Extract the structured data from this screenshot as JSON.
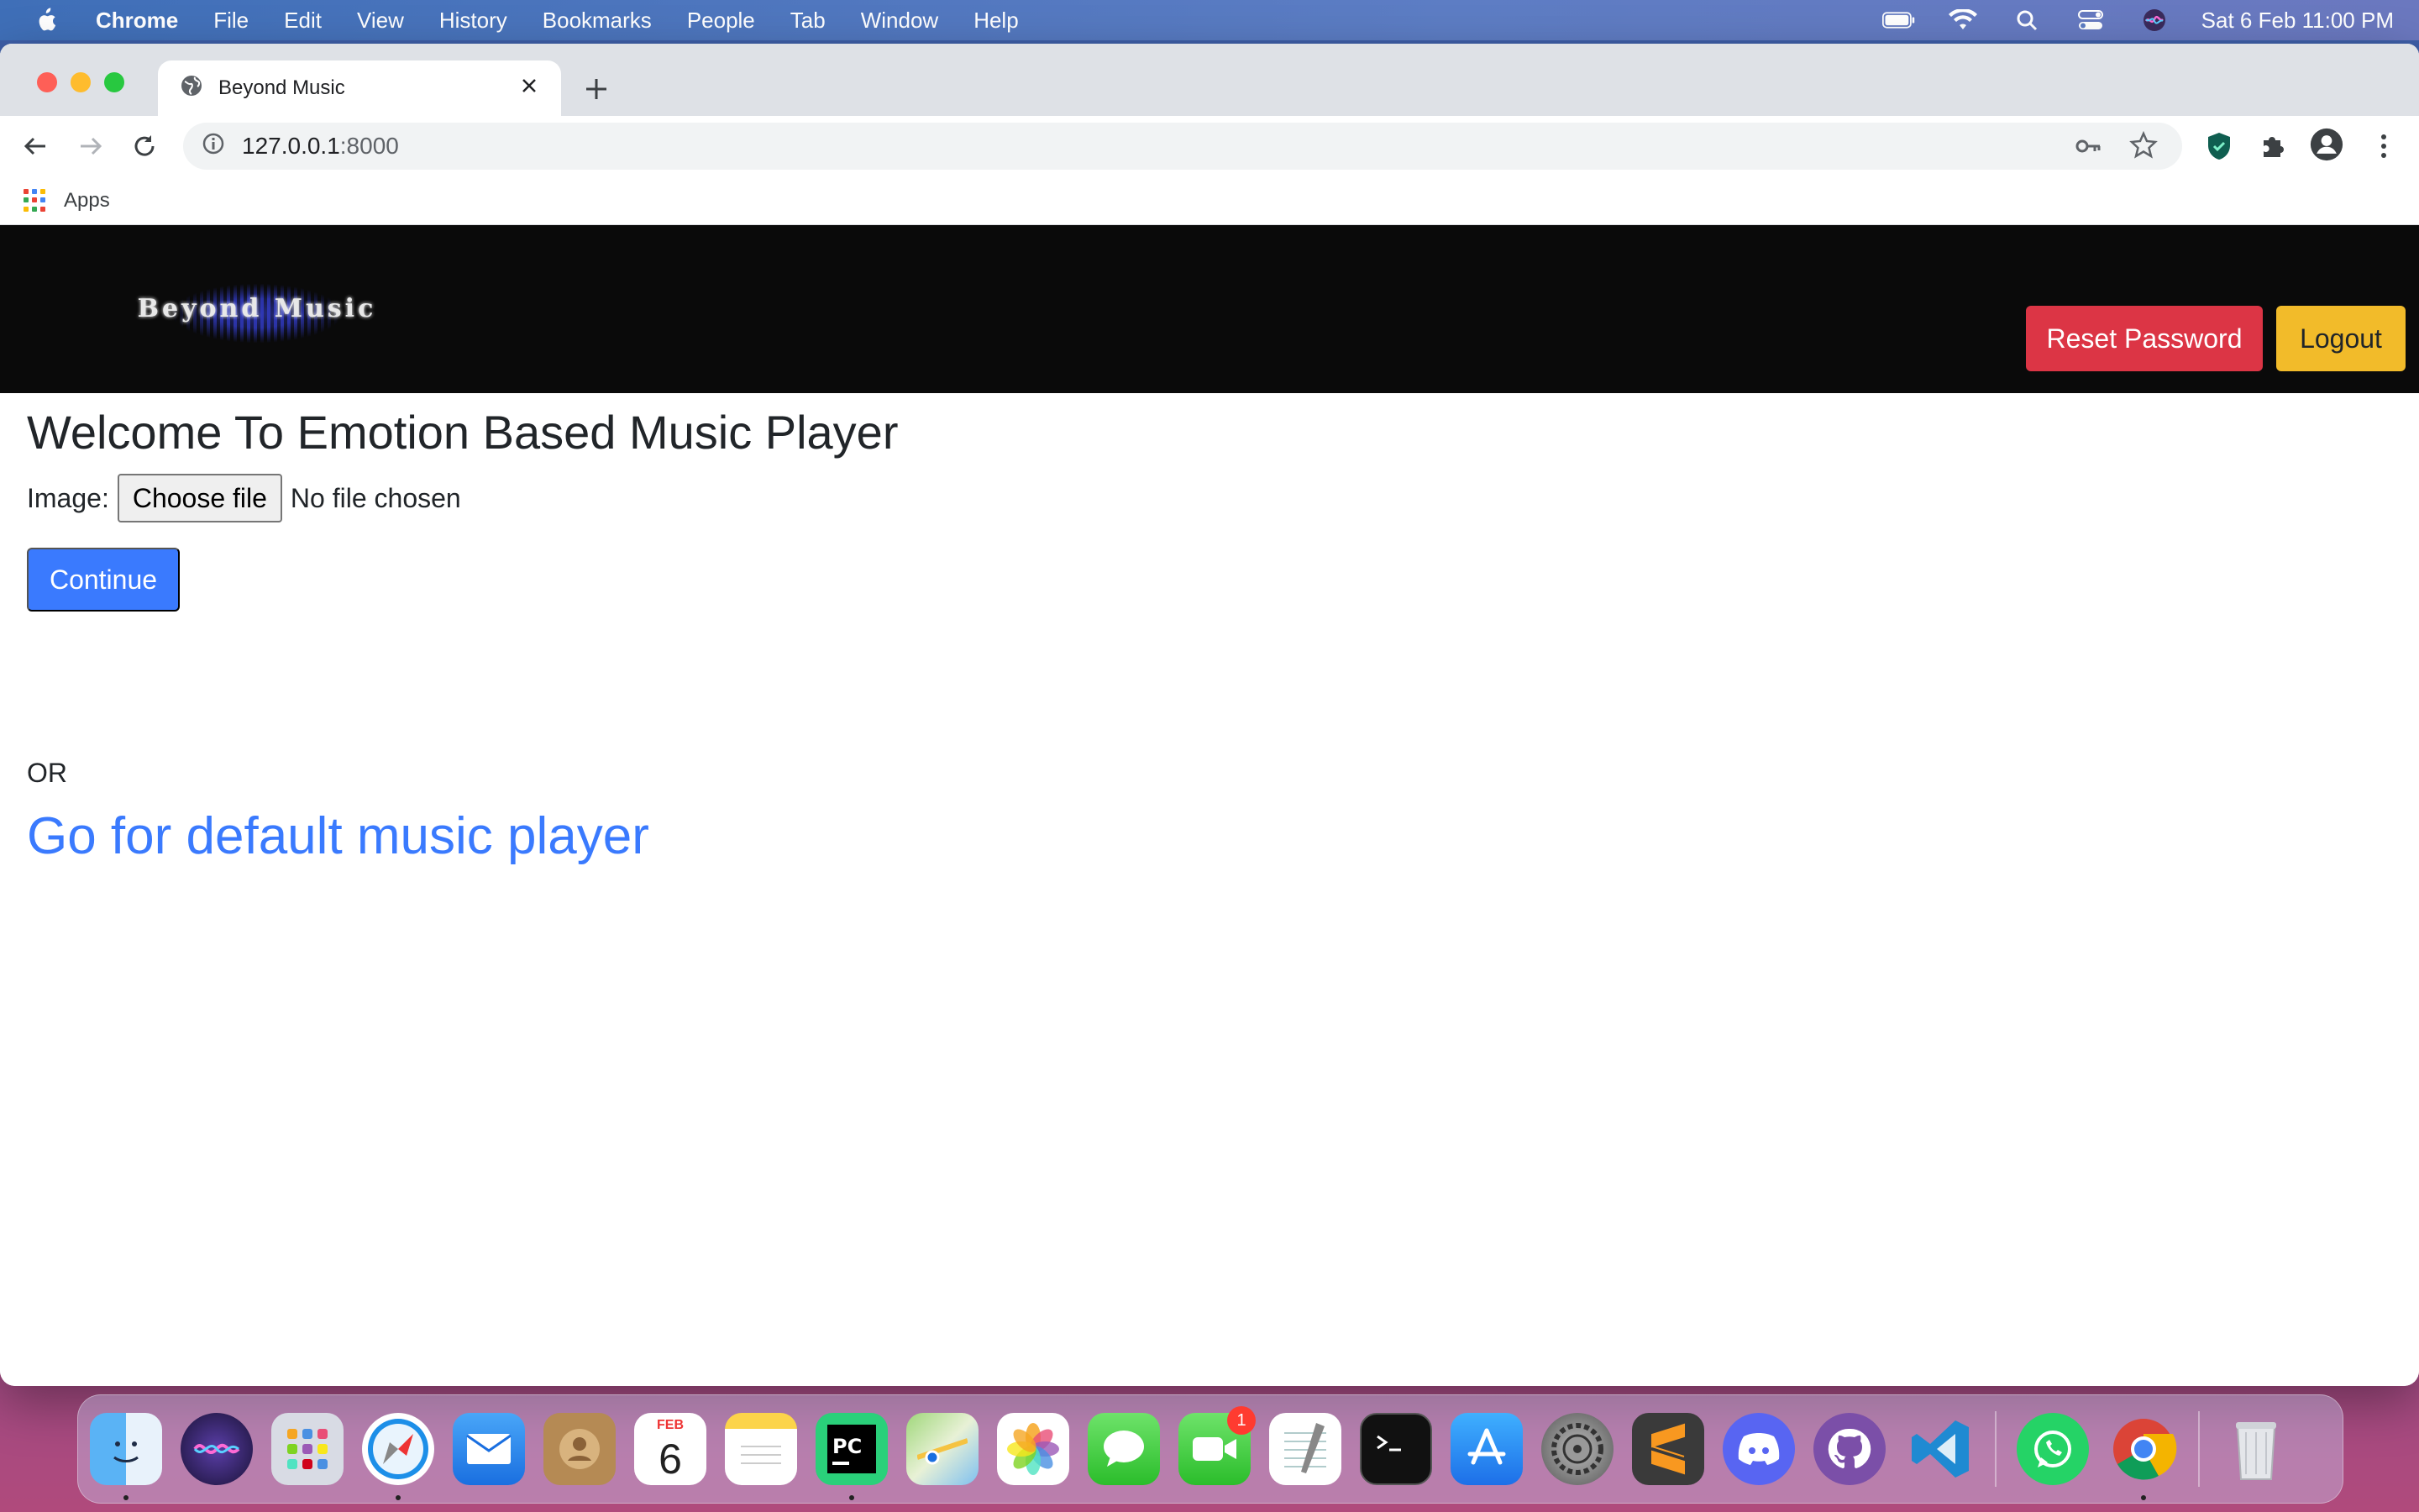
{
  "menubar": {
    "app_name": "Chrome",
    "items": [
      "File",
      "Edit",
      "View",
      "History",
      "Bookmarks",
      "People",
      "Tab",
      "Window",
      "Help"
    ],
    "datetime": "Sat 6 Feb  11:00 PM"
  },
  "browser": {
    "tab_title": "Beyond Music",
    "url_host": "127.0.0.1",
    "url_port": ":8000",
    "bookmarks_apps_label": "Apps"
  },
  "site": {
    "logo_text": "Beyond Music",
    "reset_password_label": "Reset Password",
    "logout_label": "Logout",
    "heading": "Welcome To Emotion Based Music Player",
    "image_label": "Image:",
    "choose_file_label": "Choose file",
    "file_status": "No file chosen",
    "continue_label": "Continue",
    "or_text": "OR",
    "default_link_text": "Go for default music player"
  },
  "dock": {
    "calendar_month": "FEB",
    "calendar_day": "6",
    "facetime_badge": "1"
  },
  "colors": {
    "header_bg": "#0a0a0a",
    "reset_btn": "#dc3545",
    "logout_btn": "#f2bb2a",
    "primary": "#3a7afe"
  }
}
